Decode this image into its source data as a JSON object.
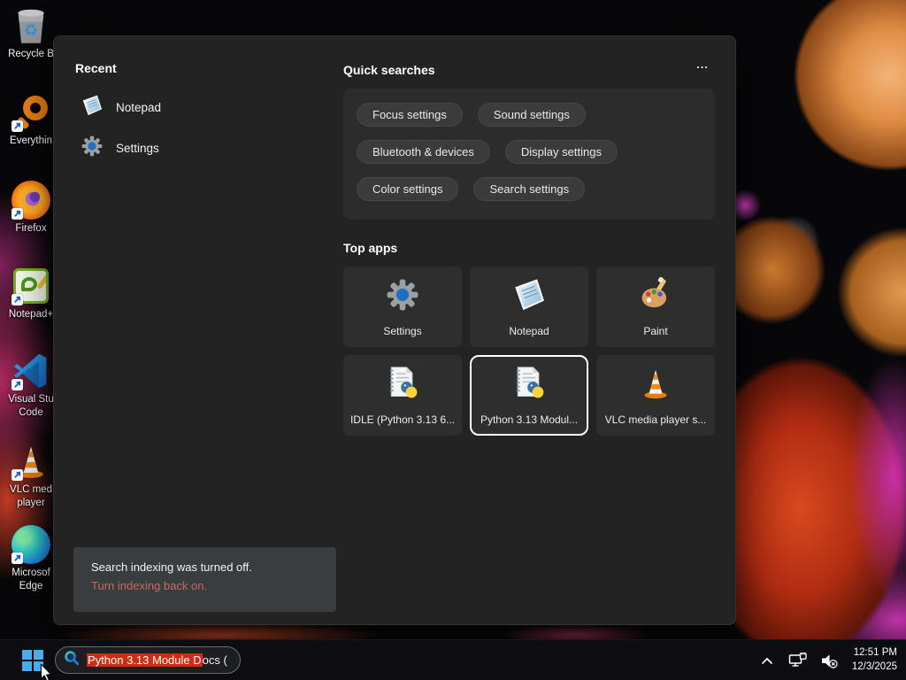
{
  "colors": {
    "selection_highlight": "#cf2d12",
    "indexing_link": "#c8695c",
    "accent_blue": "#48ade8",
    "panel_bg": "#232323",
    "taskbar_bg": "#0d0d11"
  },
  "desktop": {
    "icons": [
      {
        "icon": "recycle-bin",
        "label": "Recycle B"
      },
      {
        "icon": "everything",
        "label": "Everythin"
      },
      {
        "icon": "firefox",
        "label": "Firefox"
      },
      {
        "icon": "notepad-plus-plus",
        "label": "Notepad+"
      },
      {
        "icon": "visual-studio-code",
        "label": "Visual Stu",
        "label2": "Code"
      },
      {
        "icon": "vlc-media-player",
        "label": "VLC med",
        "label2": "player"
      },
      {
        "icon": "microsoft-edge",
        "label": "Microsof",
        "label2": "Edge"
      }
    ]
  },
  "panel": {
    "recent": {
      "title": "Recent",
      "items": [
        {
          "icon": "notepad",
          "label": "Notepad"
        },
        {
          "icon": "settings-gear",
          "label": "Settings"
        }
      ]
    },
    "quick_searches": {
      "title": "Quick searches",
      "more_label": "...",
      "pills": [
        "Focus settings",
        "Sound settings",
        "Bluetooth & devices",
        "Display settings",
        "Color settings",
        "Search settings"
      ]
    },
    "top_apps": {
      "title": "Top apps",
      "tiles": [
        {
          "icon": "settings-gear",
          "label": "Settings",
          "selected": false
        },
        {
          "icon": "notepad",
          "label": "Notepad",
          "selected": false
        },
        {
          "icon": "paint",
          "label": "Paint",
          "selected": false
        },
        {
          "icon": "python-document",
          "label": "IDLE (Python 3.13 6...",
          "selected": false
        },
        {
          "icon": "python-document",
          "label": "Python 3.13 Modul...",
          "selected": true
        },
        {
          "icon": "vlc-cone",
          "label": "VLC media player s...",
          "selected": false
        }
      ]
    },
    "indexing_notice": {
      "message": "Search indexing was turned off.",
      "link_label": "Turn indexing back on."
    }
  },
  "taskbar": {
    "search": {
      "selected_text": "Python 3.13 Module D",
      "rest_text": "ocs ("
    },
    "clock": {
      "time": "12:51 PM",
      "date": "12/3/2025"
    }
  }
}
